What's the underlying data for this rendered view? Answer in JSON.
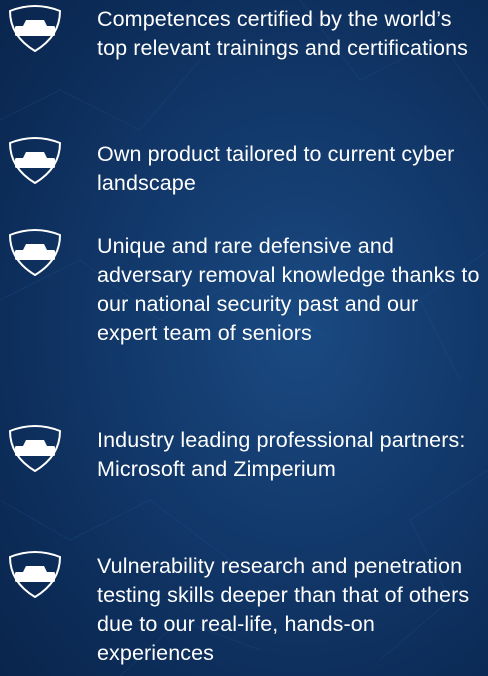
{
  "theme": {
    "background": "#0b2a55",
    "text_color": "#ffffff",
    "icon_color": "#ffffff"
  },
  "features": {
    "items": [
      {
        "icon": "shield-icon",
        "text": "Competences certified by the world’s top relevant trainings and certifications"
      },
      {
        "icon": "shield-icon",
        "text": "Own product tailored to current cyber landscape"
      },
      {
        "icon": "shield-icon",
        "text": "Unique and rare defensive and adversary removal knowledge thanks to our national security past and our expert team of seniors"
      },
      {
        "icon": "shield-icon",
        "text": "Industry leading professional partners: Microsoft and Zimperium"
      },
      {
        "icon": "shield-icon",
        "text": "Vulnerability research and penetration testing skills deeper than that of others due to our real-life, hands-on experiences"
      }
    ]
  }
}
